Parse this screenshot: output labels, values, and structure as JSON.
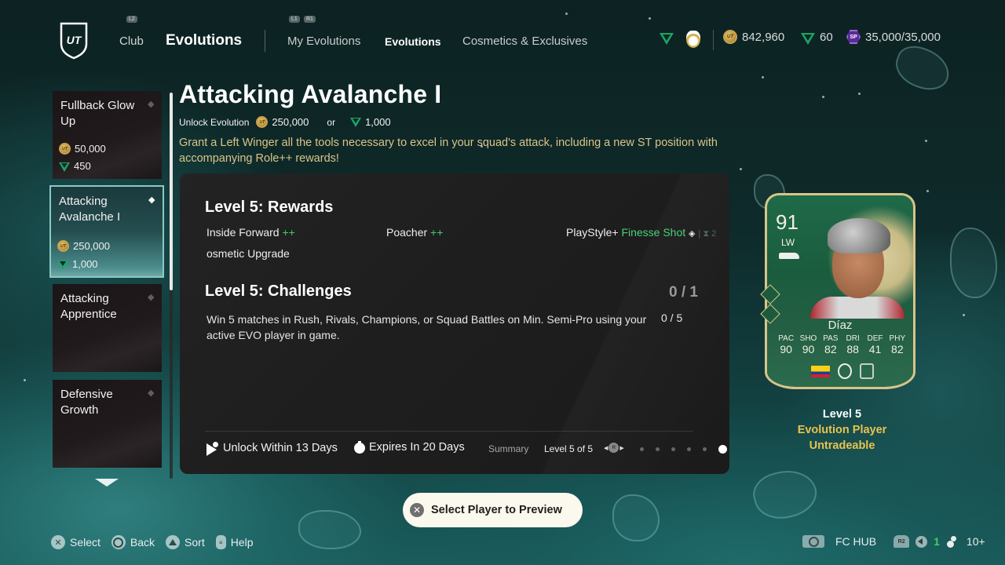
{
  "top_nav": {
    "logo": "UT",
    "club_hint": "L2",
    "club_label": "Club",
    "section_title": "Evolutions",
    "subnav_hints": [
      "L1",
      "R1"
    ],
    "tabs": [
      {
        "label": "My Evolutions",
        "active": false
      },
      {
        "label": "Evolutions",
        "active": true
      },
      {
        "label": "Cosmetics & Exclusives",
        "active": false
      }
    ],
    "coins": "842,960",
    "fc_points": "60",
    "season_points": "35,000/35,000",
    "sp_badge": "SP",
    "coin_badge": "UT"
  },
  "sidebar": {
    "items": [
      {
        "title": "Fullback Glow Up",
        "coins": "50,000",
        "points": "450",
        "selected": false
      },
      {
        "title": "Attacking Avalanche I",
        "coins": "250,000",
        "points": "1,000",
        "selected": true
      },
      {
        "title": "Attacking Apprentice",
        "selected": false
      },
      {
        "title": "Defensive Growth",
        "selected": false
      }
    ]
  },
  "detail": {
    "title": "Attacking Avalanche I",
    "unlock_label": "Unlock Evolution",
    "unlock_coins": "250,000",
    "or_label": "or",
    "unlock_points": "1,000",
    "description": "Grant a Left Winger all the tools necessary to excel in your squad's attack, including a new ST position with accompanying Role++ rewards!"
  },
  "panel": {
    "rewards_title": "Level 5: Rewards",
    "rewards": [
      {
        "label": "Inside Forward",
        "suffix": "++"
      },
      {
        "label": "Poacher",
        "suffix": "++"
      },
      {
        "prefix": "PlayStyle+",
        "label": "Finesse Shot",
        "extra": "| ⧗ 2"
      },
      {
        "label": "osmetic Upgrade"
      }
    ],
    "challenges_title": "Level 5: Challenges",
    "challenges_count": "0 / 1",
    "challenge": {
      "description": "Win 5 matches in Rush, Rivals, Champions, or Squad Battles on Min. Semi-Pro using your active EVO player in game.",
      "progress": "0 / 5"
    },
    "footer": {
      "unlock_within": "Unlock Within 13 Days",
      "expires_in": "Expires In 20 Days",
      "summary_label": "Summary",
      "level_of": "Level 5 of 5",
      "r_button": "R",
      "level_count": 6,
      "current_level": 6
    }
  },
  "player_card": {
    "rating": "91",
    "position": "LW",
    "name": "Díaz",
    "stat_labels": [
      "PAC",
      "SHO",
      "PAS",
      "DRI",
      "DEF",
      "PHY"
    ],
    "stat_values": [
      "90",
      "90",
      "82",
      "88",
      "41",
      "82"
    ],
    "card_color": "#1f6a48",
    "trim_color": "#d9c48a"
  },
  "card_info": {
    "level": "Level 5",
    "type": "Evolution Player",
    "tradeable": "Untradeable"
  },
  "preview_button": {
    "label": "Select Player to Preview",
    "icon": "✕"
  },
  "bottom_hints": [
    {
      "icon": "cross",
      "label": "Select"
    },
    {
      "icon": "circle",
      "label": "Back"
    },
    {
      "icon": "triangle",
      "label": "Sort"
    },
    {
      "icon": "touchpad",
      "label": "Help"
    }
  ],
  "bottom_right": {
    "fc_hub": "FC HUB",
    "r2": "R2",
    "notifications": "1",
    "friends": "10+"
  },
  "colors": {
    "accent_green": "#3ecb6b",
    "gold_text": "#d9c588",
    "gold_bold": "#e7c34f",
    "panel_bg": "#1e1e1e",
    "button_bg": "#fbf8ee"
  }
}
